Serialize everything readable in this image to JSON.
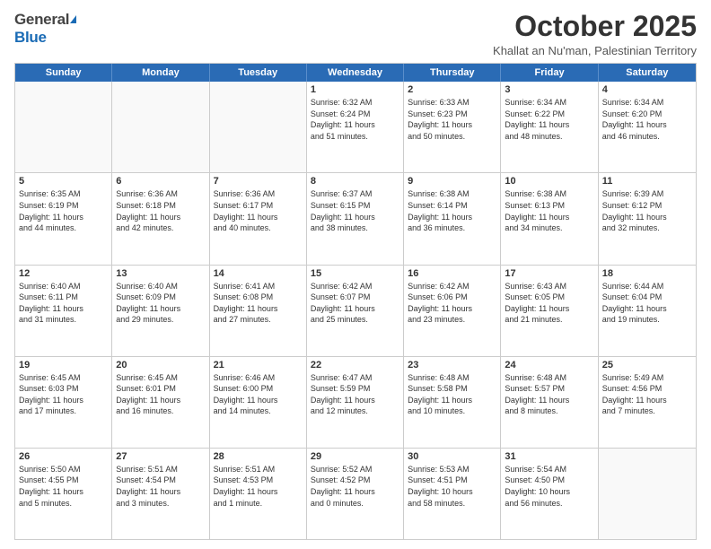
{
  "header": {
    "logo_general": "General",
    "logo_blue": "Blue",
    "month_title": "October 2025",
    "subtitle": "Khallat an Nu'man, Palestinian Territory"
  },
  "days_of_week": [
    "Sunday",
    "Monday",
    "Tuesday",
    "Wednesday",
    "Thursday",
    "Friday",
    "Saturday"
  ],
  "weeks": [
    [
      {
        "day": "",
        "content": []
      },
      {
        "day": "",
        "content": []
      },
      {
        "day": "",
        "content": []
      },
      {
        "day": "1",
        "content": [
          "Sunrise: 6:32 AM",
          "Sunset: 6:24 PM",
          "Daylight: 11 hours",
          "and 51 minutes."
        ]
      },
      {
        "day": "2",
        "content": [
          "Sunrise: 6:33 AM",
          "Sunset: 6:23 PM",
          "Daylight: 11 hours",
          "and 50 minutes."
        ]
      },
      {
        "day": "3",
        "content": [
          "Sunrise: 6:34 AM",
          "Sunset: 6:22 PM",
          "Daylight: 11 hours",
          "and 48 minutes."
        ]
      },
      {
        "day": "4",
        "content": [
          "Sunrise: 6:34 AM",
          "Sunset: 6:20 PM",
          "Daylight: 11 hours",
          "and 46 minutes."
        ]
      }
    ],
    [
      {
        "day": "5",
        "content": [
          "Sunrise: 6:35 AM",
          "Sunset: 6:19 PM",
          "Daylight: 11 hours",
          "and 44 minutes."
        ]
      },
      {
        "day": "6",
        "content": [
          "Sunrise: 6:36 AM",
          "Sunset: 6:18 PM",
          "Daylight: 11 hours",
          "and 42 minutes."
        ]
      },
      {
        "day": "7",
        "content": [
          "Sunrise: 6:36 AM",
          "Sunset: 6:17 PM",
          "Daylight: 11 hours",
          "and 40 minutes."
        ]
      },
      {
        "day": "8",
        "content": [
          "Sunrise: 6:37 AM",
          "Sunset: 6:15 PM",
          "Daylight: 11 hours",
          "and 38 minutes."
        ]
      },
      {
        "day": "9",
        "content": [
          "Sunrise: 6:38 AM",
          "Sunset: 6:14 PM",
          "Daylight: 11 hours",
          "and 36 minutes."
        ]
      },
      {
        "day": "10",
        "content": [
          "Sunrise: 6:38 AM",
          "Sunset: 6:13 PM",
          "Daylight: 11 hours",
          "and 34 minutes."
        ]
      },
      {
        "day": "11",
        "content": [
          "Sunrise: 6:39 AM",
          "Sunset: 6:12 PM",
          "Daylight: 11 hours",
          "and 32 minutes."
        ]
      }
    ],
    [
      {
        "day": "12",
        "content": [
          "Sunrise: 6:40 AM",
          "Sunset: 6:11 PM",
          "Daylight: 11 hours",
          "and 31 minutes."
        ]
      },
      {
        "day": "13",
        "content": [
          "Sunrise: 6:40 AM",
          "Sunset: 6:09 PM",
          "Daylight: 11 hours",
          "and 29 minutes."
        ]
      },
      {
        "day": "14",
        "content": [
          "Sunrise: 6:41 AM",
          "Sunset: 6:08 PM",
          "Daylight: 11 hours",
          "and 27 minutes."
        ]
      },
      {
        "day": "15",
        "content": [
          "Sunrise: 6:42 AM",
          "Sunset: 6:07 PM",
          "Daylight: 11 hours",
          "and 25 minutes."
        ]
      },
      {
        "day": "16",
        "content": [
          "Sunrise: 6:42 AM",
          "Sunset: 6:06 PM",
          "Daylight: 11 hours",
          "and 23 minutes."
        ]
      },
      {
        "day": "17",
        "content": [
          "Sunrise: 6:43 AM",
          "Sunset: 6:05 PM",
          "Daylight: 11 hours",
          "and 21 minutes."
        ]
      },
      {
        "day": "18",
        "content": [
          "Sunrise: 6:44 AM",
          "Sunset: 6:04 PM",
          "Daylight: 11 hours",
          "and 19 minutes."
        ]
      }
    ],
    [
      {
        "day": "19",
        "content": [
          "Sunrise: 6:45 AM",
          "Sunset: 6:03 PM",
          "Daylight: 11 hours",
          "and 17 minutes."
        ]
      },
      {
        "day": "20",
        "content": [
          "Sunrise: 6:45 AM",
          "Sunset: 6:01 PM",
          "Daylight: 11 hours",
          "and 16 minutes."
        ]
      },
      {
        "day": "21",
        "content": [
          "Sunrise: 6:46 AM",
          "Sunset: 6:00 PM",
          "Daylight: 11 hours",
          "and 14 minutes."
        ]
      },
      {
        "day": "22",
        "content": [
          "Sunrise: 6:47 AM",
          "Sunset: 5:59 PM",
          "Daylight: 11 hours",
          "and 12 minutes."
        ]
      },
      {
        "day": "23",
        "content": [
          "Sunrise: 6:48 AM",
          "Sunset: 5:58 PM",
          "Daylight: 11 hours",
          "and 10 minutes."
        ]
      },
      {
        "day": "24",
        "content": [
          "Sunrise: 6:48 AM",
          "Sunset: 5:57 PM",
          "Daylight: 11 hours",
          "and 8 minutes."
        ]
      },
      {
        "day": "25",
        "content": [
          "Sunrise: 5:49 AM",
          "Sunset: 4:56 PM",
          "Daylight: 11 hours",
          "and 7 minutes."
        ]
      }
    ],
    [
      {
        "day": "26",
        "content": [
          "Sunrise: 5:50 AM",
          "Sunset: 4:55 PM",
          "Daylight: 11 hours",
          "and 5 minutes."
        ]
      },
      {
        "day": "27",
        "content": [
          "Sunrise: 5:51 AM",
          "Sunset: 4:54 PM",
          "Daylight: 11 hours",
          "and 3 minutes."
        ]
      },
      {
        "day": "28",
        "content": [
          "Sunrise: 5:51 AM",
          "Sunset: 4:53 PM",
          "Daylight: 11 hours",
          "and 1 minute."
        ]
      },
      {
        "day": "29",
        "content": [
          "Sunrise: 5:52 AM",
          "Sunset: 4:52 PM",
          "Daylight: 11 hours",
          "and 0 minutes."
        ]
      },
      {
        "day": "30",
        "content": [
          "Sunrise: 5:53 AM",
          "Sunset: 4:51 PM",
          "Daylight: 10 hours",
          "and 58 minutes."
        ]
      },
      {
        "day": "31",
        "content": [
          "Sunrise: 5:54 AM",
          "Sunset: 4:50 PM",
          "Daylight: 10 hours",
          "and 56 minutes."
        ]
      },
      {
        "day": "",
        "content": []
      }
    ]
  ]
}
